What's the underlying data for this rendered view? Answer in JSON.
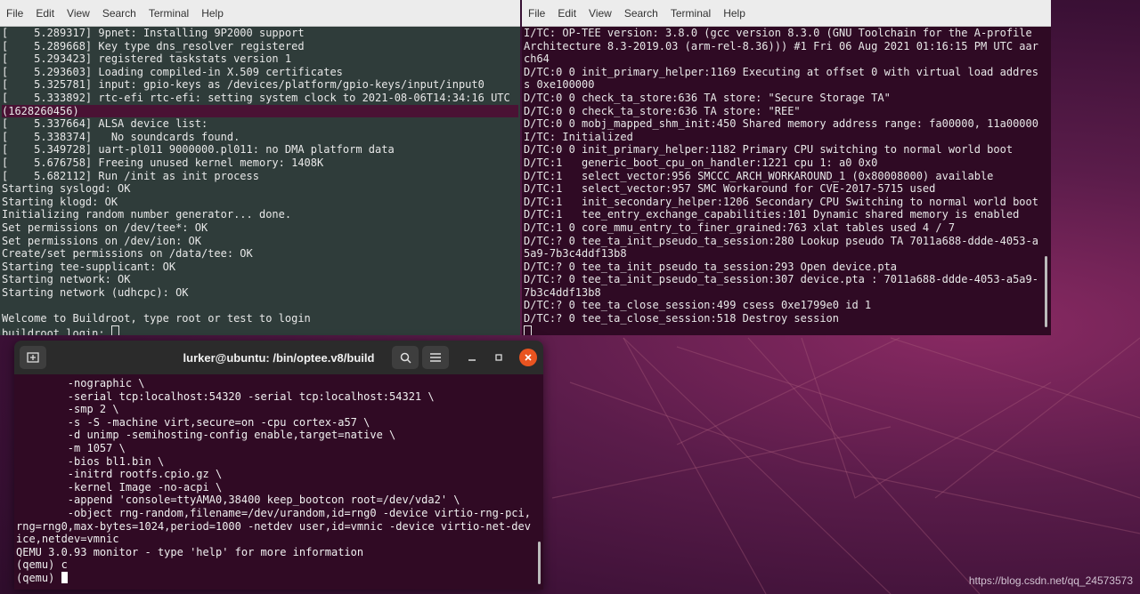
{
  "menu": [
    "File",
    "Edit",
    "View",
    "Search",
    "Terminal",
    "Help"
  ],
  "term1": {
    "lines": [
      "[    5.289317] 9pnet: Installing 9P2000 support",
      "[    5.289668] Key type dns_resolver registered",
      "[    5.293423] registered taskstats version 1",
      "[    5.293603] Loading compiled-in X.509 certificates",
      "[    5.325781] input: gpio-keys as /devices/platform/gpio-keys/input/input0",
      "[    5.333892] rtc-efi rtc-efi: setting system clock to 2021-08-06T14:34:16 UTC",
      "(1628260456)",
      "[    5.337664] ALSA device list:",
      "[    5.338374]   No soundcards found.",
      "[    5.349728] uart-pl011 9000000.pl011: no DMA platform data",
      "[    5.676758] Freeing unused kernel memory: 1408K",
      "[    5.682112] Run /init as init process",
      "Starting syslogd: OK",
      "Starting klogd: OK",
      "Initializing random number generator... done.",
      "Set permissions on /dev/tee*: OK",
      "Set permissions on /dev/ion: OK",
      "Create/set permissions on /data/tee: OK",
      "Starting tee-supplicant: OK",
      "Starting network: OK",
      "Starting network (udhcpc): OK",
      "",
      "Welcome to Buildroot, type root or test to login"
    ],
    "prompt": "buildroot login: "
  },
  "term2": {
    "lines": [
      "I/TC: OP-TEE version: 3.8.0 (gcc version 8.3.0 (GNU Toolchain for the A-profile",
      "Architecture 8.3-2019.03 (arm-rel-8.36))) #1 Fri 06 Aug 2021 01:16:15 PM UTC aar",
      "ch64",
      "D/TC:0 0 init_primary_helper:1169 Executing at offset 0 with virtual load addres",
      "s 0xe100000",
      "D/TC:0 0 check_ta_store:636 TA store: \"Secure Storage TA\"",
      "D/TC:0 0 check_ta_store:636 TA store: \"REE\"",
      "D/TC:0 0 mobj_mapped_shm_init:450 Shared memory address range: fa00000, 11a00000",
      "I/TC: Initialized",
      "D/TC:0 0 init_primary_helper:1182 Primary CPU switching to normal world boot",
      "D/TC:1   generic_boot_cpu_on_handler:1221 cpu 1: a0 0x0",
      "D/TC:1   select_vector:956 SMCCC_ARCH_WORKAROUND_1 (0x80008000) available",
      "D/TC:1   select_vector:957 SMC Workaround for CVE-2017-5715 used",
      "D/TC:1   init_secondary_helper:1206 Secondary CPU Switching to normal world boot",
      "D/TC:1   tee_entry_exchange_capabilities:101 Dynamic shared memory is enabled",
      "D/TC:1 0 core_mmu_entry_to_finer_grained:763 xlat tables used 4 / 7",
      "D/TC:? 0 tee_ta_init_pseudo_ta_session:280 Lookup pseudo TA 7011a688-ddde-4053-a",
      "5a9-7b3c4ddf13b8",
      "D/TC:? 0 tee_ta_init_pseudo_ta_session:293 Open device.pta",
      "D/TC:? 0 tee_ta_init_pseudo_ta_session:307 device.pta : 7011a688-ddde-4053-a5a9-",
      "7b3c4ddf13b8",
      "D/TC:? 0 tee_ta_close_session:499 csess 0xe1799e0 id 1",
      "D/TC:? 0 tee_ta_close_session:518 Destroy session"
    ]
  },
  "term3": {
    "title": "lurker@ubuntu: /bin/optee.v8/build",
    "lines": [
      "        -nographic \\",
      "        -serial tcp:localhost:54320 -serial tcp:localhost:54321 \\",
      "        -smp 2 \\",
      "        -s -S -machine virt,secure=on -cpu cortex-a57 \\",
      "        -d unimp -semihosting-config enable,target=native \\",
      "        -m 1057 \\",
      "        -bios bl1.bin \\",
      "        -initrd rootfs.cpio.gz \\",
      "        -kernel Image -no-acpi \\",
      "        -append 'console=ttyAMA0,38400 keep_bootcon root=/dev/vda2' \\",
      "        -object rng-random,filename=/dev/urandom,id=rng0 -device virtio-rng-pci,",
      "rng=rng0,max-bytes=1024,period=1000 -netdev user,id=vmnic -device virtio-net-dev",
      "ice,netdev=vmnic",
      "QEMU 3.0.93 monitor - type 'help' for more information",
      "(qemu) c"
    ],
    "prompt": "(qemu) "
  },
  "watermark": "https://blog.csdn.net/qq_24573573"
}
